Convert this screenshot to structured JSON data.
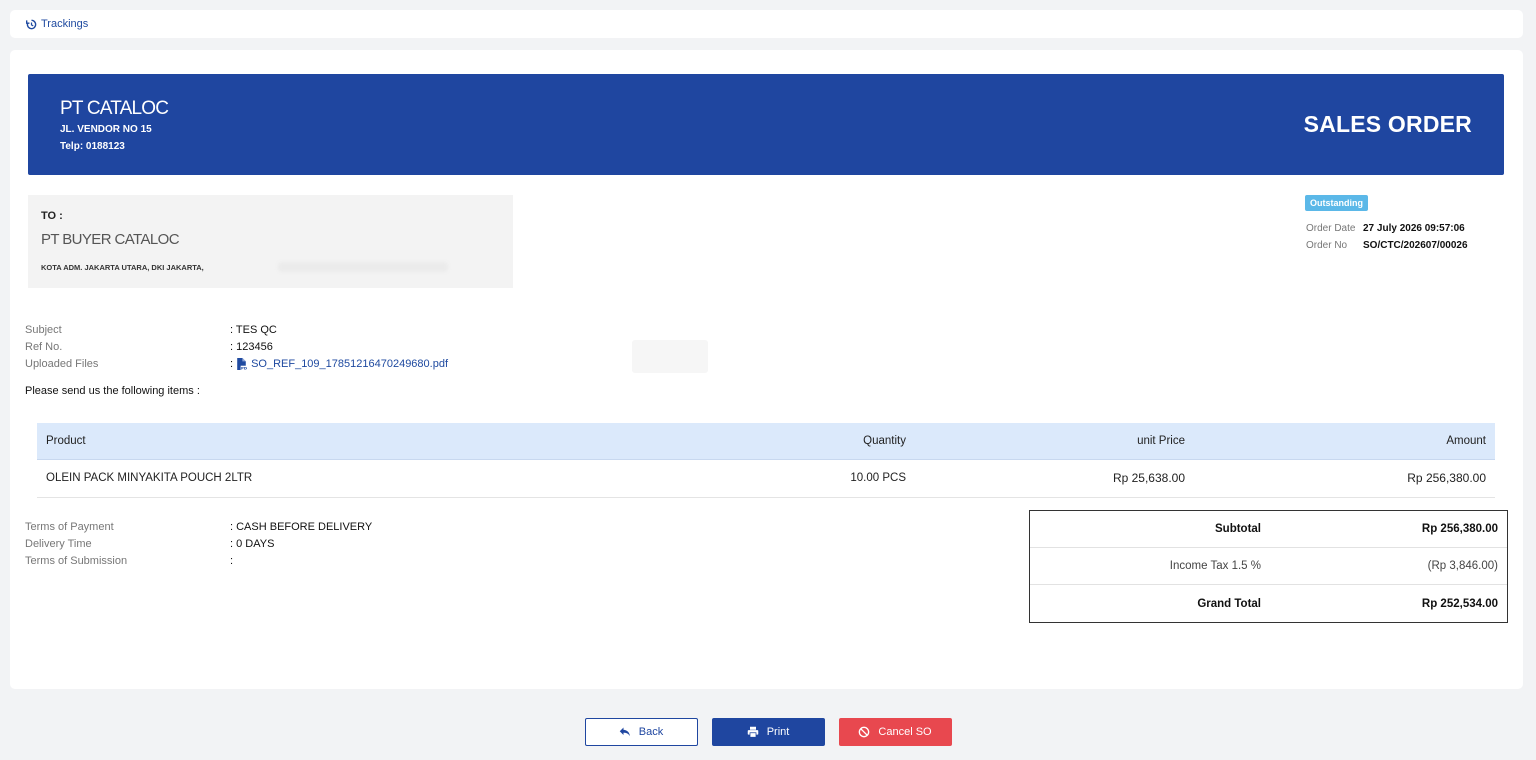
{
  "header": {
    "tracking_label": "Trackings"
  },
  "company": {
    "name": "PT CATALOC",
    "address": "JL. VENDOR NO 15",
    "phone": "Telp: 0188123"
  },
  "document": {
    "title": "SALES ORDER",
    "status": "Outstanding",
    "order_date_label": "Order Date",
    "order_date": "27 July 2026 09:57:06",
    "order_no_label": "Order No",
    "order_no": "SO/CTC/202607/00026"
  },
  "recipient": {
    "label": "TO :",
    "name": "PT BUYER CATALOC",
    "address": "KOTA ADM. JAKARTA UTARA, DKI JAKARTA,"
  },
  "info": {
    "subject_label": "Subject",
    "subject": ": TES QC",
    "ref_label": "Ref No.",
    "ref": ": 123456",
    "files_label": "Uploaded Files",
    "files_prefix": ":",
    "file_name": "SO_REF_109_17851216470249680.pdf"
  },
  "intro_text": "Please send us the following items :",
  "items": {
    "headers": {
      "product": "Product",
      "quantity": "Quantity",
      "unit_price": "unit Price",
      "amount": "Amount"
    },
    "rows": [
      {
        "product": "OLEIN PACK MINYAKITA POUCH 2LTR",
        "quantity": "10.00 PCS",
        "unit_price": "Rp 25,638.00",
        "amount": "Rp 256,380.00"
      }
    ]
  },
  "terms": {
    "payment_label": "Terms of Payment",
    "payment": ": CASH BEFORE DELIVERY",
    "delivery_label": "Delivery Time",
    "delivery": ": 0 DAYS",
    "submission_label": "Terms of Submission",
    "submission": ":"
  },
  "totals": {
    "subtotal_label": "Subtotal",
    "subtotal": "Rp 256,380.00",
    "tax_label": "Income Tax 1.5 %",
    "tax": "(Rp 3,846.00)",
    "grand_label": "Grand Total",
    "grand": "Rp 252,534.00"
  },
  "actions": {
    "back": "Back",
    "print": "Print",
    "cancel": "Cancel SO"
  },
  "colors": {
    "primary": "#1f46a0",
    "danger": "#e8484f",
    "status": "#5bb8e8",
    "table_header": "#dbe9fb"
  },
  "icons": {
    "tracking": "history-icon",
    "file": "pdf-file-icon",
    "back": "reply-arrow-icon",
    "print": "printer-icon",
    "cancel": "ban-icon"
  }
}
